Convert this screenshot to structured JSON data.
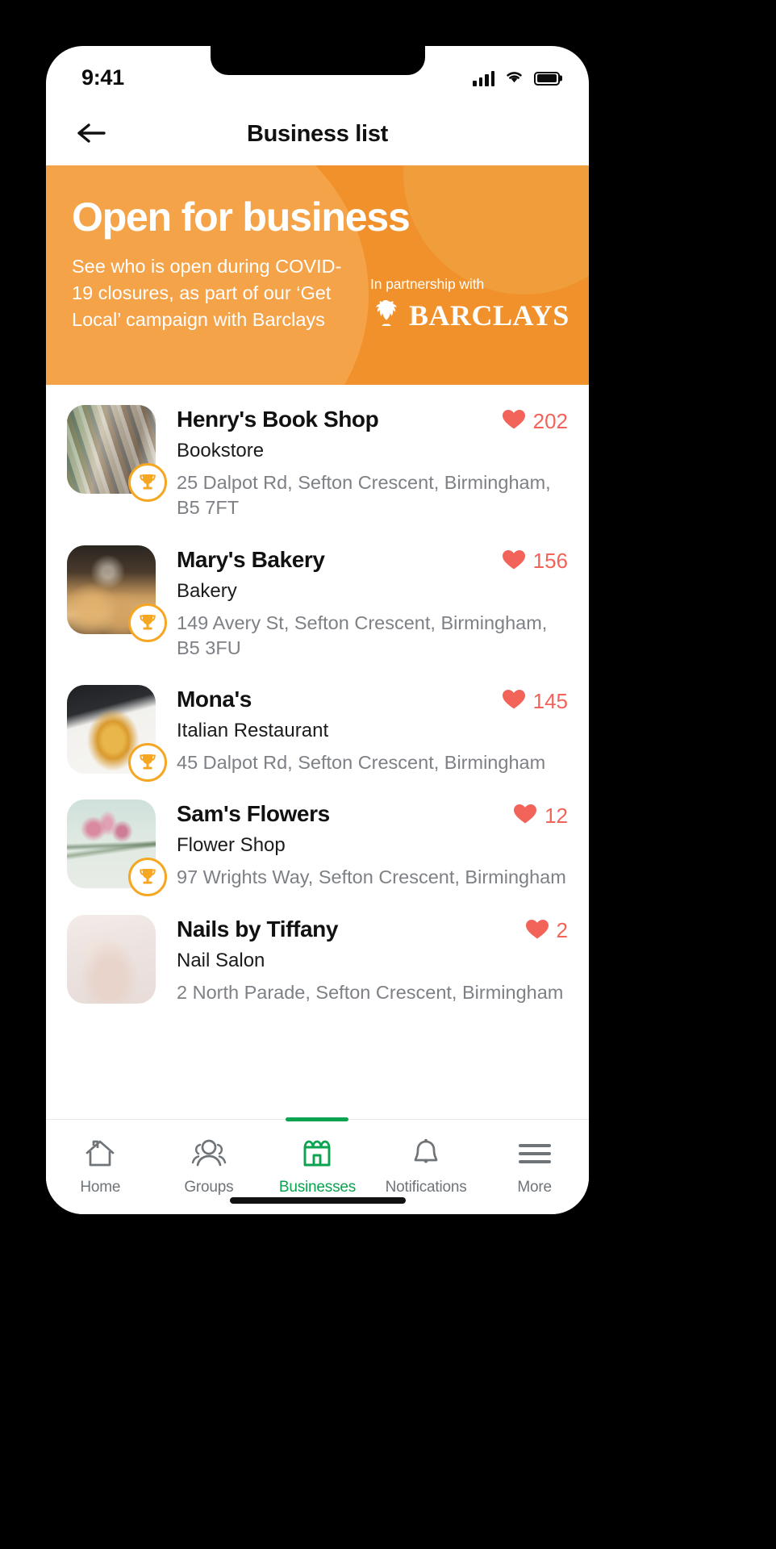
{
  "status_bar": {
    "time": "9:41",
    "icons": [
      "cellular-signal-icon",
      "wifi-icon",
      "battery-icon"
    ]
  },
  "header": {
    "title": "Business list",
    "back_icon": "arrow-left-icon"
  },
  "promo_banner": {
    "title": "Open for business",
    "subtitle": "See who is open during COVID-19 closures, as part of our ‘Get Local’ campaign with Barclays",
    "partner_label": "In partnership with",
    "partner_name": "BARCLAYS",
    "partner_logo_icon": "barclays-eagle-icon",
    "background_color": "#F0912B",
    "text_color": "#FFFFFF"
  },
  "colors": {
    "accent_orange": "#F0912B",
    "heart_red": "#F2635A",
    "active_green": "#0AA34F",
    "muted_gray": "#7D8085",
    "trophy_gold": "#F5A623"
  },
  "businesses": [
    {
      "name": "Henry's Book Shop",
      "category": "Bookstore",
      "address": "25 Dalpot Rd, Sefton Crescent, Birmingham, B5 7FT",
      "likes": "202",
      "award": true,
      "thumbnail": "bookstore-photo"
    },
    {
      "name": "Mary's Bakery",
      "category": "Bakery",
      "address": "149 Avery St, Sefton Crescent, Birmingham, B5 3FU",
      "likes": "156",
      "award": true,
      "thumbnail": "bakery-photo"
    },
    {
      "name": "Mona's",
      "category": "Italian Restaurant",
      "address": "45 Dalpot Rd, Sefton Crescent, Birmingham",
      "likes": "145",
      "award": true,
      "thumbnail": "pasta-photo"
    },
    {
      "name": "Sam's Flowers",
      "category": "Flower Shop",
      "address": "97 Wrights Way, Sefton Crescent, Birmingham",
      "likes": "12",
      "award": true,
      "thumbnail": "flowers-photo"
    },
    {
      "name": "Nails by Tiffany",
      "category": "Nail Salon",
      "address": "2 North Parade, Sefton Crescent, Birmingham",
      "likes": "2",
      "award": false,
      "thumbnail": "nails-photo"
    }
  ],
  "bottom_nav": {
    "items": [
      {
        "label": "Home",
        "icon": "house-icon",
        "active": false
      },
      {
        "label": "Groups",
        "icon": "people-icon",
        "active": false
      },
      {
        "label": "Businesses",
        "icon": "storefront-icon",
        "active": true
      },
      {
        "label": "Notifications",
        "icon": "bell-icon",
        "active": false
      },
      {
        "label": "More",
        "icon": "hamburger-menu-icon",
        "active": false
      }
    ]
  }
}
